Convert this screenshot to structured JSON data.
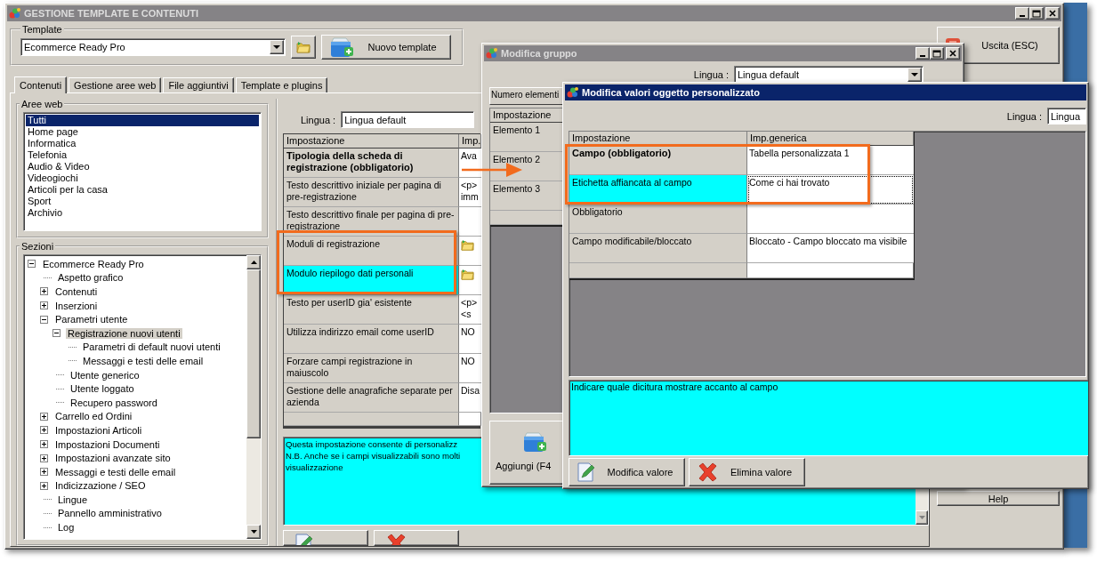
{
  "main_window": {
    "title": "GESTIONE TEMPLATE E CONTENUTI",
    "active": false,
    "template": {
      "label": "Template",
      "value": "Ecommerce Ready Pro",
      "new_button": "Nuovo template"
    },
    "exit_button": "Uscita (ESC)",
    "tabs": [
      {
        "label": "Contenuti",
        "selected": true
      },
      {
        "label": "Gestione aree web",
        "selected": false
      },
      {
        "label": "File aggiuntivi",
        "selected": false
      },
      {
        "label": "Template e plugins",
        "selected": false
      }
    ],
    "web_areas": {
      "label": "Aree web",
      "items": [
        {
          "label": "Tutti",
          "selected": true
        },
        {
          "label": "Home page",
          "selected": false
        },
        {
          "label": "Informatica",
          "selected": false
        },
        {
          "label": "Telefonia",
          "selected": false
        },
        {
          "label": "Audio & Video",
          "selected": false
        },
        {
          "label": "Videogiochi",
          "selected": false
        },
        {
          "label": "Articoli per la casa",
          "selected": false
        },
        {
          "label": "Sport",
          "selected": false
        },
        {
          "label": "Archivio",
          "selected": false
        }
      ]
    },
    "sections": {
      "label": "Sezioni",
      "tree": [
        {
          "label": "Ecommerce Ready Pro",
          "expanded": true,
          "selected": false,
          "children": [
            {
              "label": "Aspetto grafico",
              "selected": false
            },
            {
              "label": "Contenuti",
              "expanded": false,
              "selected": false
            },
            {
              "label": "Inserzioni",
              "expanded": false,
              "selected": false
            },
            {
              "label": "Parametri utente",
              "expanded": true,
              "selected": false,
              "children": [
                {
                  "label": "Registrazione nuovi utenti",
                  "expanded": true,
                  "selected": true,
                  "children": [
                    {
                      "label": "Parametri di default nuovi utenti",
                      "selected": false
                    },
                    {
                      "label": "Messaggi e testi delle email",
                      "selected": false
                    }
                  ]
                },
                {
                  "label": "Utente generico",
                  "selected": false
                },
                {
                  "label": "Utente loggato",
                  "selected": false
                },
                {
                  "label": "Recupero password",
                  "selected": false
                }
              ]
            },
            {
              "label": "Carrello ed Ordini",
              "expanded": false,
              "selected": false
            },
            {
              "label": "Impostazioni Articoli",
              "expanded": false,
              "selected": false
            },
            {
              "label": "Impostazioni Documenti",
              "expanded": false,
              "selected": false
            },
            {
              "label": "Impostazioni avanzate sito",
              "expanded": false,
              "selected": false
            },
            {
              "label": "Messaggi e testi delle email",
              "expanded": false,
              "selected": false
            },
            {
              "label": "Indicizzazione / SEO",
              "expanded": false,
              "selected": false
            },
            {
              "label": "Lingue",
              "selected": false
            },
            {
              "label": "Pannello amministrativo",
              "selected": false
            },
            {
              "label": "Log",
              "selected": false
            }
          ]
        }
      ]
    },
    "language": {
      "label": "Lingua :",
      "value": "Lingua default"
    },
    "settings_table": {
      "columns": [
        "Impostazione",
        "Imp."
      ],
      "rows": [
        {
          "kind": "text",
          "name": "Tipologia della scheda di registrazione (obbligatorio)",
          "required": true,
          "selected": false,
          "value_lines": [
            "Ava"
          ]
        },
        {
          "kind": "text",
          "name": "Testo descrittivo iniziale per pagina di pre-registrazione",
          "required": false,
          "selected": false,
          "value_lines": [
            "<p>",
            "imm"
          ]
        },
        {
          "kind": "text",
          "name": "Testo descrittivo finale per pagina di pre-registrazione",
          "required": false,
          "selected": false
        },
        {
          "kind": "folder",
          "name": "Moduli di registrazione",
          "required": false,
          "selected": false
        },
        {
          "kind": "folder",
          "name": "Modulo riepilogo dati personali",
          "required": false,
          "selected": true
        },
        {
          "kind": "text",
          "name": "Testo per userID gia' esistente",
          "required": false,
          "selected": false,
          "value_lines": [
            "<p>",
            "<s"
          ]
        },
        {
          "kind": "text",
          "name": "Utilizza indirizzo email come userID",
          "required": false,
          "selected": false,
          "value_lines": [
            "NO"
          ]
        },
        {
          "kind": "text",
          "name": "Forzare campi registrazione in maiuscolo",
          "required": false,
          "selected": false,
          "value_lines": [
            "NO"
          ]
        },
        {
          "kind": "text",
          "name": "Gestione delle anagrafiche separate per azienda",
          "required": false,
          "selected": false,
          "value_lines": [
            "Disa"
          ]
        },
        {
          "kind": "blank"
        }
      ]
    },
    "description_lines": [
      "Questa impostazione consente di personalizz",
      "N.B. Anche se i campi visualizzabili sono molti",
      "visualizzazione"
    ],
    "bottom_buttons": [
      {
        "kind": "edit"
      },
      {
        "kind": "delete"
      }
    ],
    "help_button": "Help"
  },
  "group_dialog": {
    "title": "Modifica gruppo",
    "active": false,
    "language": {
      "label": "Lingua :",
      "value": "Lingua default"
    },
    "count_label": "Numero elementi",
    "table": {
      "columns": [
        "Impostazione"
      ],
      "rows": [
        {
          "kind": "item",
          "name": "Elemento 1"
        },
        {
          "kind": "item",
          "name": "Elemento 2"
        },
        {
          "kind": "item",
          "name": "Elemento 3"
        },
        {
          "kind": "blank"
        }
      ]
    },
    "add_button": "Aggiungi (F4"
  },
  "values_dialog": {
    "title": "Modifica valori oggetto personalizzato",
    "active": true,
    "language": {
      "label": "Lingua :",
      "value": "Lingua"
    },
    "table": {
      "columns": [
        "Impostazione",
        "Imp.generica"
      ],
      "rows": [
        {
          "kind": "field",
          "name": "Campo (obbligatorio)",
          "value": "Tabella personalizzata 1",
          "required": true,
          "selected": false
        },
        {
          "kind": "field",
          "name": "Etichetta affiancata al campo",
          "value": "Come ci hai trovato",
          "required": false,
          "selected": true
        },
        {
          "kind": "field",
          "name": "Obbligatorio",
          "required": false,
          "selected": false
        },
        {
          "kind": "field",
          "name": "Campo modificabile/bloccato",
          "value": "Bloccato - Campo bloccato ma visibile",
          "required": false,
          "selected": false
        },
        {
          "kind": "blank"
        }
      ]
    },
    "description": "Indicare quale dicitura mostrare accanto al campo",
    "buttons": [
      {
        "label": "Modifica valore",
        "kind": "edit"
      },
      {
        "label": "Elimina valore",
        "kind": "delete"
      }
    ]
  }
}
